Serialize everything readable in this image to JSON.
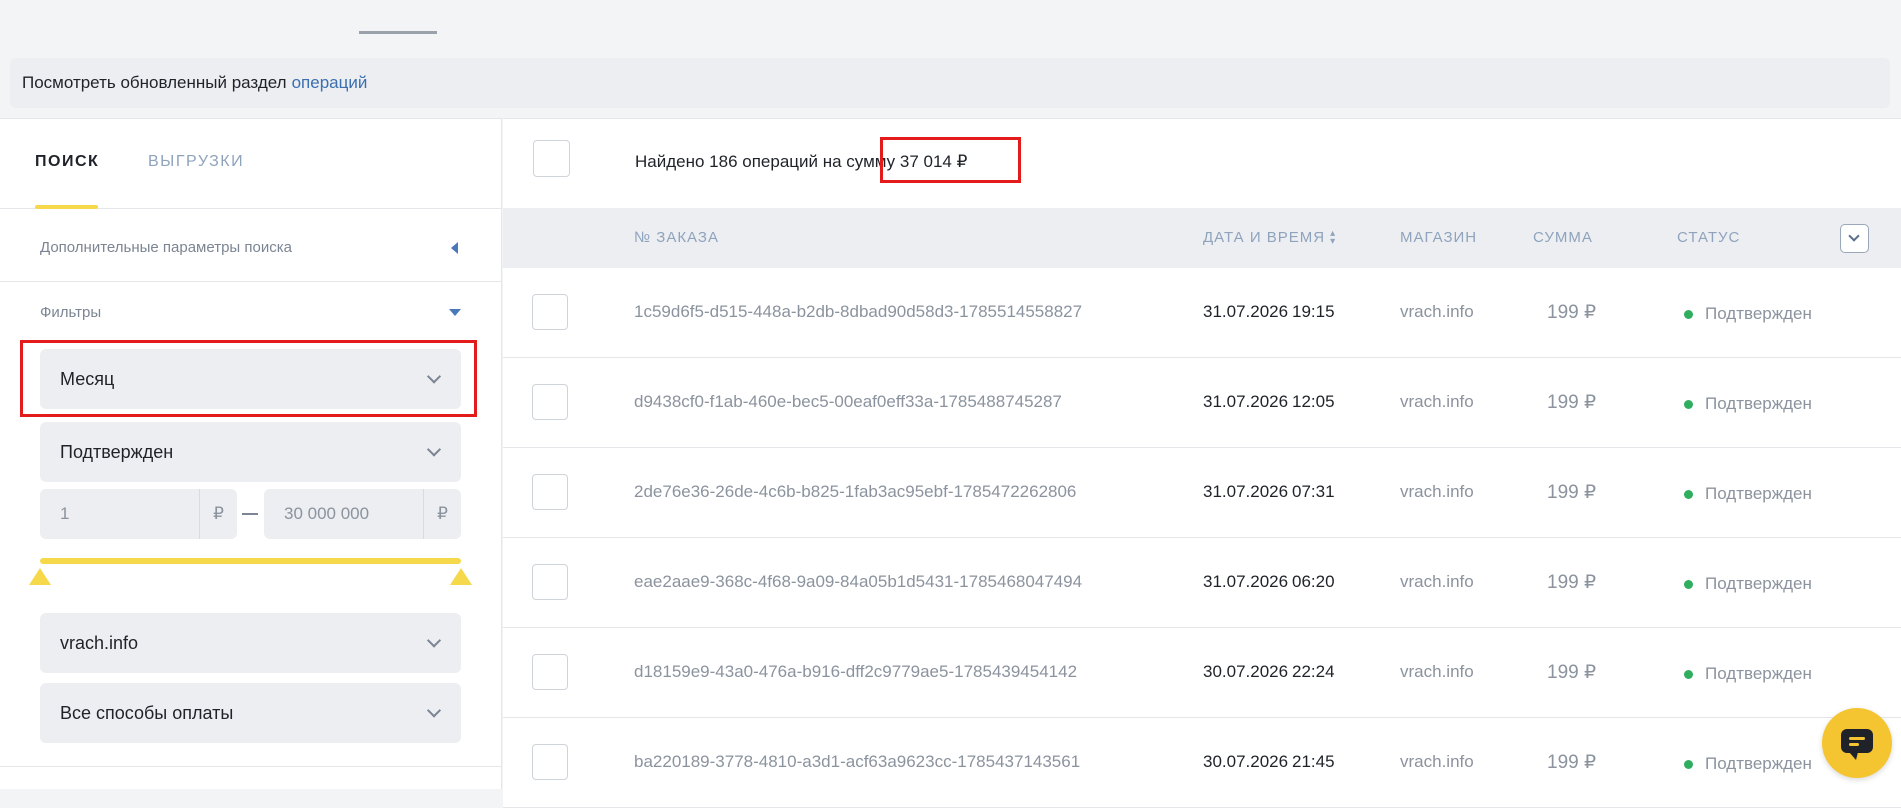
{
  "notice": {
    "text": "Посмотреть обновленный раздел",
    "link": "операций"
  },
  "left_tabs": {
    "search": "ПОИСК",
    "exports": "ВЫГРУЗКИ"
  },
  "sections": {
    "advanced": "Дополнительные параметры поиска",
    "filters": "Фильтры"
  },
  "filters": {
    "period": "Месяц",
    "status": "Подтвержден",
    "amount_from": "1",
    "amount_to": "30 000 000",
    "currency": "₽",
    "shop": "vrach.info",
    "payment": "Все способы оплаты",
    "amount_range": {
      "min_fraction": 0,
      "max_fraction": 1
    }
  },
  "summary": {
    "text": "Найдено 186 операций на сумму 37 014 ₽"
  },
  "columns": {
    "order": "№ ЗАКАЗА",
    "datetime": "ДАТА И ВРЕМЯ",
    "shop": "МАГАЗИН",
    "sum": "СУММА",
    "status": "СТАТУС"
  },
  "colors": {
    "accent_yellow": "#f5d94a",
    "status_green": "#2fae5f",
    "highlight_red": "#e31b1b",
    "link_blue": "#3a6fb0"
  },
  "icons": {
    "sort": "sort-arrows-icon",
    "column_toggle": "chevron-down-icon",
    "chat": "chat-icon"
  },
  "rows": [
    {
      "id": "1c59d6f5-d515-448a-b2db-8dbad90d58d3-1785514558827",
      "date": "31.07.2026",
      "time": "19:15",
      "shop": "vrach.info",
      "sum": "199 ₽",
      "status": "Подтвержден"
    },
    {
      "id": "d9438cf0-f1ab-460e-bec5-00eaf0eff33a-1785488745287",
      "date": "31.07.2026",
      "time": "12:05",
      "shop": "vrach.info",
      "sum": "199 ₽",
      "status": "Подтвержден"
    },
    {
      "id": "2de76e36-26de-4c6b-b825-1fab3ac95ebf-1785472262806",
      "date": "31.07.2026",
      "time": "07:31",
      "shop": "vrach.info",
      "sum": "199 ₽",
      "status": "Подтвержден"
    },
    {
      "id": "eae2aae9-368c-4f68-9a09-84a05b1d5431-1785468047494",
      "date": "31.07.2026",
      "time": "06:20",
      "shop": "vrach.info",
      "sum": "199 ₽",
      "status": "Подтвержден"
    },
    {
      "id": "d18159e9-43a0-476a-b916-dff2c9779ae5-1785439454142",
      "date": "30.07.2026",
      "time": "22:24",
      "shop": "vrach.info",
      "sum": "199 ₽",
      "status": "Подтвержден"
    },
    {
      "id": "ba220189-3778-4810-a3d1-acf63a9623cc-1785437143561",
      "date": "30.07.2026",
      "time": "21:45",
      "shop": "vrach.info",
      "sum": "199 ₽",
      "status": "Подтвержден"
    }
  ]
}
